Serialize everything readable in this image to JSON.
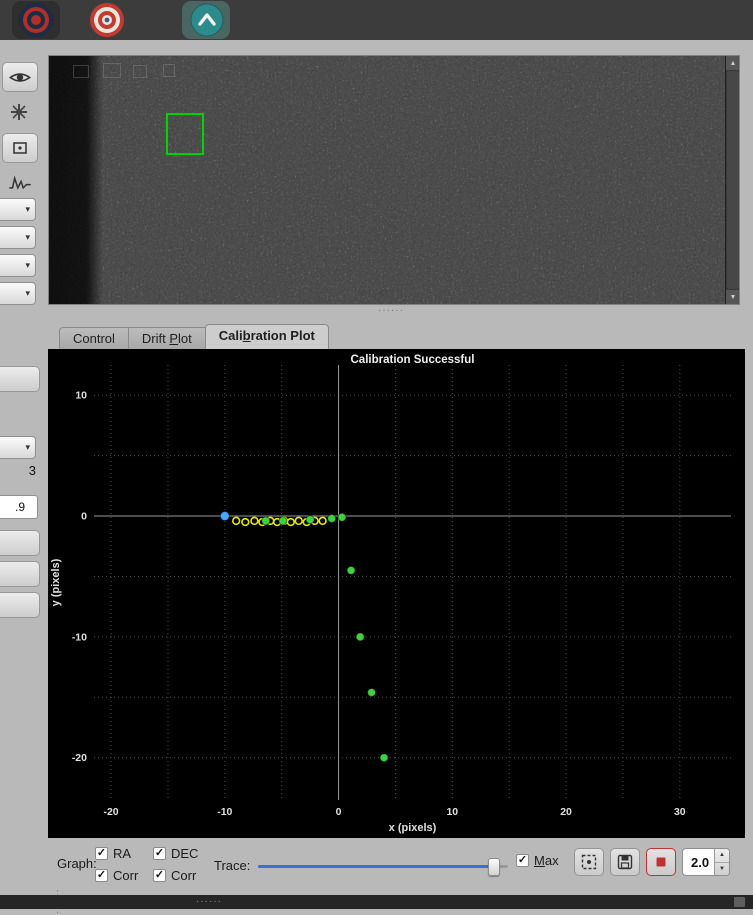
{
  "colors": {
    "toolbar_bg": "#3c3c3c",
    "panel_bg": "#b9b9b9",
    "plot_bg": "#000000",
    "selection_green": "#00d200",
    "slider_blue": "#3a6fd8",
    "stop_red": "#c03232",
    "ra_yellow": "#e8e800",
    "dec_green": "#3fd23f",
    "start_blue": "#45a6ff"
  },
  "toolbar": {
    "buttons": [
      {
        "icon": "target-dark-icon"
      },
      {
        "icon": "target-red-icon"
      },
      {
        "icon": "guide-up-arrow-icon"
      }
    ]
  },
  "sidebar": {
    "partial_value_top": "3",
    "partial_value_bottom": ".9"
  },
  "tabs": {
    "items": [
      {
        "label": "Control",
        "active": false
      },
      {
        "label": "Drift Plot",
        "mnemonic": "P",
        "active": false
      },
      {
        "label": "Calibration Plot",
        "mnemonic": "b",
        "active": true
      }
    ]
  },
  "chart_data": {
    "type": "scatter",
    "title": "Calibration Successful",
    "xlabel": "x (pixels)",
    "ylabel": "y (pixels)",
    "xlim": [
      -21.5,
      34.5
    ],
    "ylim": [
      -23.5,
      12.5
    ],
    "xticks": [
      -20,
      -10,
      0,
      10,
      20,
      30
    ],
    "yticks": [
      10,
      0,
      -10,
      -20
    ],
    "grid_step": 5,
    "grid": true,
    "background": "#000000",
    "legend": "none",
    "series": [
      {
        "name": "calibration-start",
        "color": "#45a6ff",
        "marker": "filled",
        "size": 4.5,
        "points": [
          [
            -10.0,
            0.0
          ]
        ]
      },
      {
        "name": "ra-west-steps",
        "color": "#e8e800",
        "marker": "open",
        "size": 3.4,
        "points": [
          [
            -9.0,
            -0.4
          ],
          [
            -8.2,
            -0.5
          ],
          [
            -7.4,
            -0.4
          ],
          [
            -6.7,
            -0.5
          ],
          [
            -6.0,
            -0.4
          ],
          [
            -5.4,
            -0.5
          ],
          [
            -4.8,
            -0.4
          ],
          [
            -4.2,
            -0.5
          ],
          [
            -3.5,
            -0.4
          ],
          [
            -2.8,
            -0.5
          ],
          [
            -2.1,
            -0.4
          ],
          [
            -1.4,
            -0.4
          ]
        ]
      },
      {
        "name": "dec-north-steps",
        "color": "#3fd23f",
        "marker": "filled",
        "size": 4,
        "points": [
          [
            -6.4,
            -0.4
          ],
          [
            -4.9,
            -0.4
          ],
          [
            -2.5,
            -0.3
          ],
          [
            -0.6,
            -0.2
          ],
          [
            0.3,
            -0.1
          ],
          [
            1.1,
            -4.5
          ],
          [
            1.9,
            -10.0
          ],
          [
            2.9,
            -14.6
          ],
          [
            4.0,
            -20.0
          ]
        ]
      }
    ]
  },
  "controls": {
    "graph_label": "Graph:",
    "checkboxes": [
      {
        "label": "RA",
        "checked": true
      },
      {
        "label": "DEC",
        "checked": true
      },
      {
        "label": "Corr",
        "checked": true
      },
      {
        "label": "Corr",
        "checked": true
      }
    ],
    "trace_label": "Trace:",
    "max_checkbox": {
      "label": "Max",
      "checked": true,
      "mnemonic": "M"
    },
    "buttons": [
      {
        "icon": "auto-select-star-icon"
      },
      {
        "icon": "save-icon"
      },
      {
        "icon": "stop-icon"
      }
    ],
    "scale_value": "2.0"
  },
  "icons": {
    "check": "✓",
    "dropdown": "▾",
    "scroll_up": "▲",
    "scroll_down": "▼",
    "spin_up": "▲",
    "spin_down": "▼",
    "handle_dots": "······"
  }
}
